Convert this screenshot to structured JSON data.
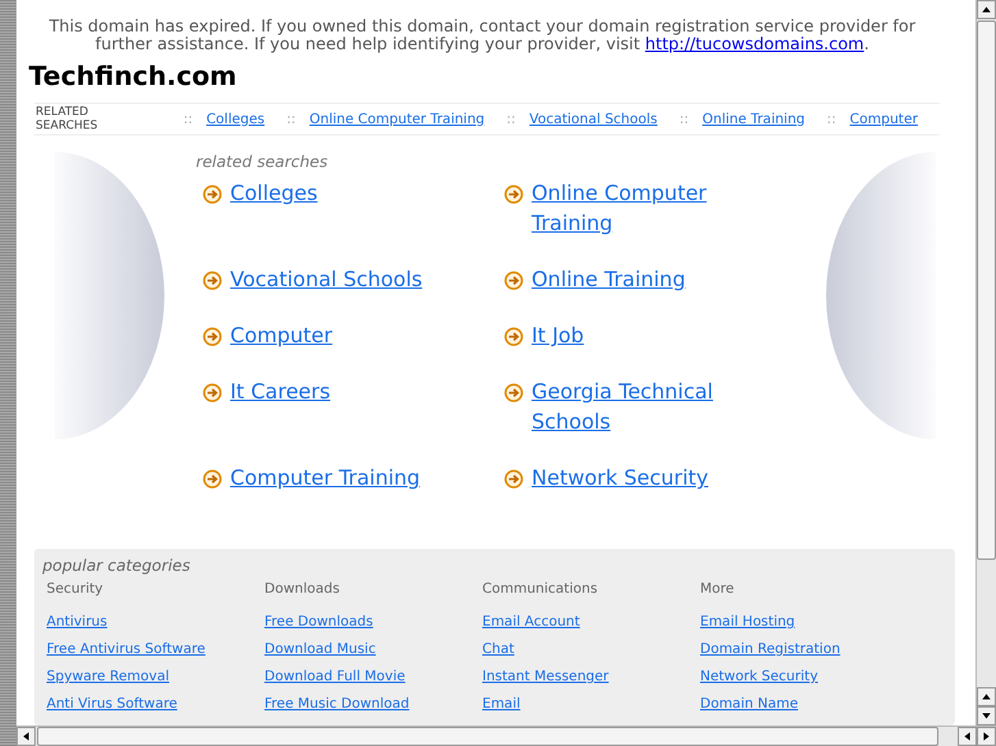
{
  "notice": {
    "text": "This domain has expired. If you owned this domain, contact your domain registration service provider for further assistance. If you need help identifying your provider, visit ",
    "link": "http://tucowsdomains.com",
    "end": "."
  },
  "site_title": "Techfinch.com",
  "related_bar": {
    "label": "RELATED SEARCHES",
    "links": [
      {
        "separator": "::",
        "text": "Colleges"
      },
      {
        "separator": "::",
        "text": "Online Computer Training"
      },
      {
        "separator": "::",
        "text": "Vocational Schools"
      },
      {
        "separator": "::",
        "text": "Online Training"
      },
      {
        "separator": "::",
        "text": "Computer"
      }
    ]
  },
  "related_searches": {
    "heading": "related searches",
    "links": [
      "Colleges",
      "Online Computer Training",
      "Vocational Schools",
      "Online Training",
      "Computer",
      "It Job",
      "It Careers",
      "Georgia Technical Schools",
      "Computer Training",
      "Network Security"
    ]
  },
  "popular_categories": {
    "heading": "popular categories",
    "columns": [
      {
        "title": "Security",
        "links": [
          "Antivirus",
          "Free Antivirus Software",
          "Spyware Removal",
          "Anti Virus Software"
        ]
      },
      {
        "title": "Downloads",
        "links": [
          "Free Downloads",
          "Download Music",
          "Download Full Movie",
          "Free Music Download"
        ]
      },
      {
        "title": "Communications",
        "links": [
          "Email Account",
          "Chat",
          "Instant Messenger",
          "Email"
        ]
      },
      {
        "title": "More",
        "links": [
          "Email Hosting",
          "Domain Registration",
          "Network Security",
          "Domain Name"
        ]
      }
    ]
  }
}
